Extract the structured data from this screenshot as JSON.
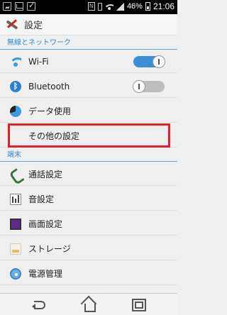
{
  "status_bar": {
    "battery_percent": "46%",
    "time": "21:06",
    "nfc_label": "N"
  },
  "action_bar": {
    "title": "設定"
  },
  "sections": {
    "wireless": {
      "header": "無線とネットワーク",
      "items": [
        {
          "label": "Wi-Fi",
          "icon": "wifi-icon",
          "toggle": "on"
        },
        {
          "label": "Bluetooth",
          "icon": "bluetooth-icon",
          "toggle": "off"
        },
        {
          "label": "データ使用",
          "icon": "data-usage-icon"
        },
        {
          "label": "その他の設定",
          "icon": null
        }
      ]
    },
    "device": {
      "header": "端末",
      "items": [
        {
          "label": "通話設定",
          "icon": "phone-icon"
        },
        {
          "label": "音設定",
          "icon": "sound-icon"
        },
        {
          "label": "画面設定",
          "icon": "display-icon"
        },
        {
          "label": "ストレージ",
          "icon": "storage-icon"
        },
        {
          "label": "電源管理",
          "icon": "power-icon"
        }
      ]
    }
  },
  "bluetooth_glyph": "ᛒ",
  "colors": {
    "accent": "#2f8ac9",
    "toggle_on": "#3a8fd6",
    "highlight": "#e3202a"
  }
}
